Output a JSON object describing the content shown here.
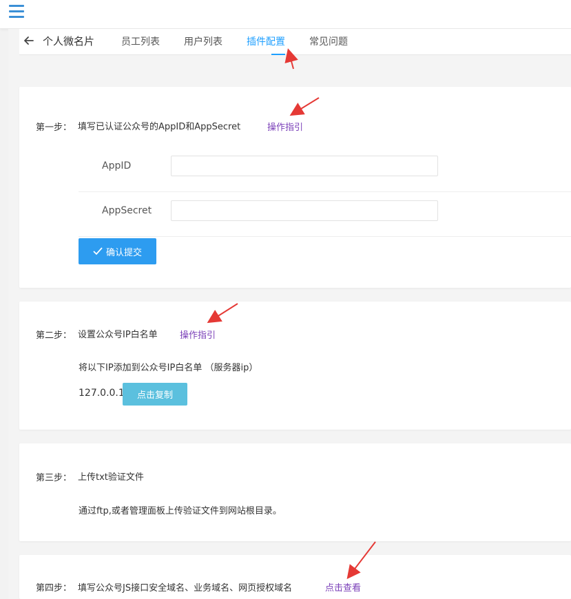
{
  "nav": {
    "title": "个人微名片",
    "tabs": [
      "员工列表",
      "用户列表",
      "插件配置",
      "常见问题"
    ],
    "active_tab": 2
  },
  "step1": {
    "label": "第一步：",
    "text": "填写已认证公众号的AppID和AppSecret",
    "guide": "操作指引",
    "fields": [
      {
        "label": "AppID",
        "value": ""
      },
      {
        "label": "AppSecret",
        "value": ""
      }
    ],
    "submit_label": "确认提交"
  },
  "step2": {
    "label": "第二步：",
    "text": "设置公众号IP白名单",
    "guide": "操作指引",
    "desc": "将以下IP添加到公众号IP白名单 （服务器ip）",
    "ip": "127.0.0.1",
    "copy_label": "点击复制"
  },
  "step3": {
    "label": "第三步：",
    "text": "上传txt验证文件",
    "desc": "通过ftp,或者管理面板上传验证文件到网站根目录。"
  },
  "step4": {
    "label": "第四步：",
    "text": "填写公众号JS接口安全域名、业务域名、网页授权域名",
    "view": "点击查看"
  },
  "colors": {
    "accent": "#1E9FFF",
    "link": "#7a3fb8",
    "submit_bg": "#2d9cf0",
    "copy_bg": "#5bc0de",
    "annotation_arrow": "#e53935"
  }
}
